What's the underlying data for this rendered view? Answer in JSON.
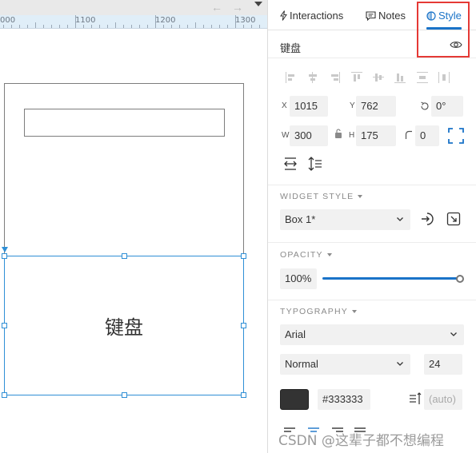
{
  "toolbar": {
    "back_arrow": "←",
    "forward_arrow": "→"
  },
  "ruler": {
    "labels": [
      "000",
      "1100",
      "1200",
      "1300"
    ]
  },
  "canvas": {
    "selected_widget_text": "键盘"
  },
  "panel": {
    "tabs": {
      "interactions": "Interactions",
      "notes": "Notes",
      "style": "Style"
    },
    "widget_name": "键盘",
    "position": {
      "x_label": "X",
      "x_value": "1015",
      "y_label": "Y",
      "y_value": "762",
      "rotation_value": "0°"
    },
    "size": {
      "w_label": "W",
      "w_value": "300",
      "h_label": "H",
      "h_value": "175",
      "corner_value": "0"
    },
    "widget_style": {
      "title": "WIDGET STYLE",
      "selected": "Box 1*"
    },
    "opacity": {
      "title": "OPACITY",
      "value": "100%",
      "level": 1.0
    },
    "typography": {
      "title": "TYPOGRAPHY",
      "font": "Arial",
      "weight": "Normal",
      "size": "24",
      "color_hex": "#333333",
      "line_spacing": "(auto)"
    }
  },
  "watermark": "CSDN @这辈子都不想编程",
  "colors": {
    "accent": "#1a73c8",
    "selection": "#2f8fd6",
    "highlight": "#e53935",
    "text_color_swatch": "#333333"
  }
}
